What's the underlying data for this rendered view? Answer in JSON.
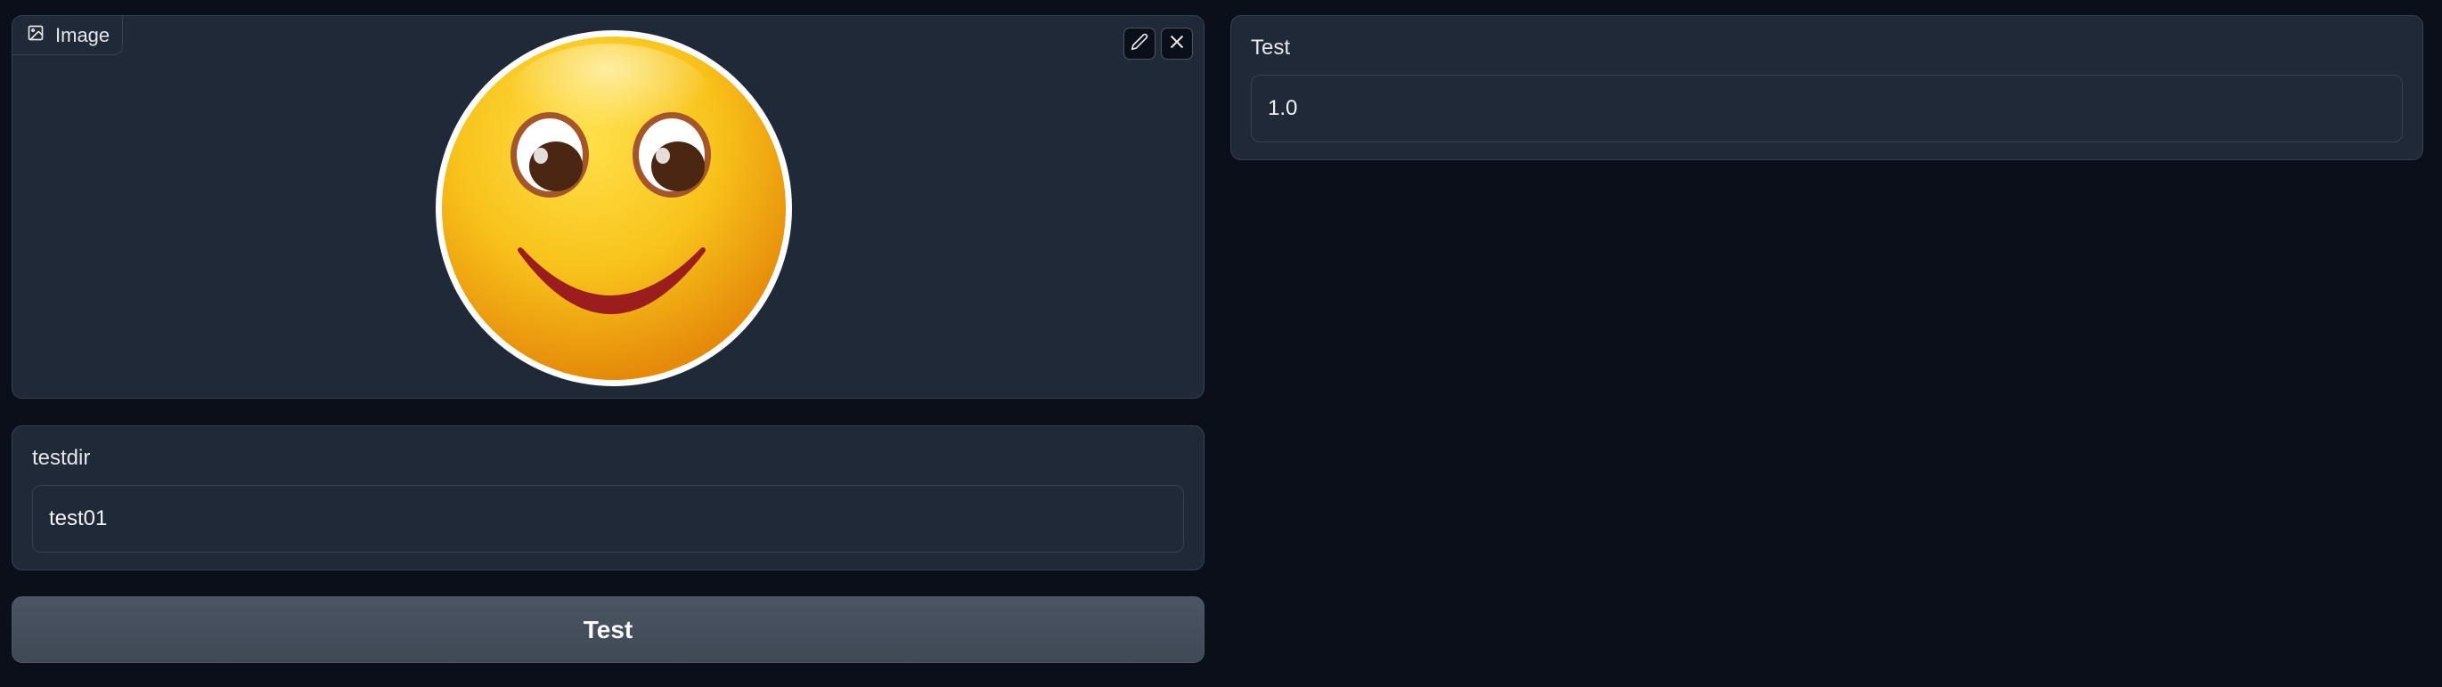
{
  "image_panel": {
    "label": "Image",
    "label_icon": "image-icon",
    "edit_icon": "pencil-icon",
    "clear_icon": "close-icon",
    "image_content": "smiley-face-emoji"
  },
  "testdir": {
    "label": "testdir",
    "value": "test01"
  },
  "submit": {
    "label": "Test"
  },
  "output": {
    "label": "Test",
    "value": "1.0"
  },
  "colors": {
    "background": "#0b0f19",
    "panel": "#1f2937",
    "border": "#374151",
    "button": "#4b5563"
  }
}
